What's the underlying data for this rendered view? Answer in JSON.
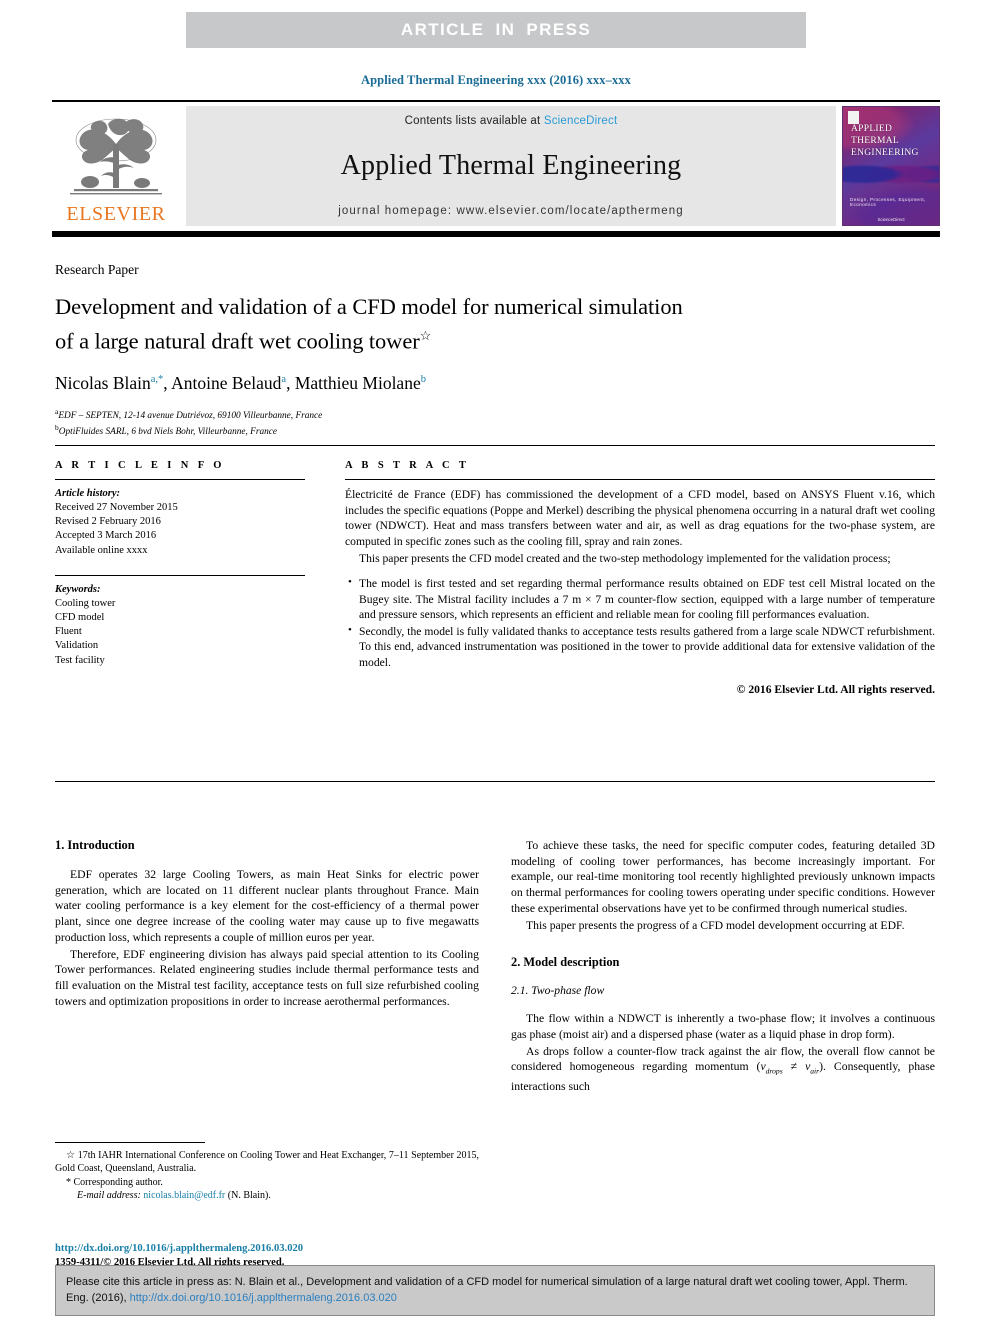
{
  "banner": {
    "text": "ARTICLE IN PRESS"
  },
  "running_head": "Applied Thermal Engineering xxx (2016) xxx–xxx",
  "masthead": {
    "contents_prefix": "Contents lists available at ",
    "sciencedirect": "ScienceDirect",
    "journal_title": "Applied Thermal Engineering",
    "homepage": "journal homepage: www.elsevier.com/locate/apthermeng",
    "publisher_wordmark": "ELSEVIER",
    "cover": {
      "line1": "APPLIED",
      "line2": "THERMAL",
      "line3": "ENGINEERING",
      "subtitle": "Design, Processes, Equipment, Economics",
      "footer": "ScienceDirect"
    }
  },
  "article": {
    "kind": "Research Paper",
    "title_line1": "Development and validation of a CFD model for numerical simulation",
    "title_line2": "of a large natural draft wet cooling tower",
    "title_star": "☆",
    "authors": [
      {
        "name": "Nicolas Blain",
        "marks": "a,*"
      },
      {
        "name": "Antoine Belaud",
        "marks": "a"
      },
      {
        "name": "Matthieu Miolane",
        "marks": "b"
      }
    ],
    "affiliations": [
      {
        "mark": "a",
        "text": "EDF – SEPTEN, 12-14 avenue Dutriévoz, 69100 Villeurbanne, France"
      },
      {
        "mark": "b",
        "text": "OptiFluides SARL, 6 bvd Niels Bohr, Villeurbanne, France"
      }
    ]
  },
  "article_info": {
    "heading": "A R T I C L E  I N F O",
    "history_label": "Article history:",
    "history": [
      "Received 27 November 2015",
      "Revised 2 February 2016",
      "Accepted 3 March 2016",
      "Available online xxxx"
    ],
    "keywords_label": "Keywords:",
    "keywords": [
      "Cooling tower",
      "CFD model",
      "Fluent",
      "Validation",
      "Test facility"
    ]
  },
  "abstract": {
    "heading": "A B S T R A C T",
    "paragraph1": "Électricité de France (EDF) has commissioned the development of a CFD model, based on ANSYS Fluent v.16, which includes the specific equations (Poppe and Merkel) describing the physical phenomena occurring in a natural draft wet cooling tower (NDWCT). Heat and mass transfers between water and air, as well as drag equations for the two-phase system, are computed in specific zones such as the cooling fill, spray and rain zones.",
    "paragraph2": "This paper presents the CFD model created and the two-step methodology implemented for the validation process;",
    "bullets": [
      "The model is first tested and set regarding thermal performance results obtained on EDF test cell Mistral located on the Bugey site. The Mistral facility includes a 7 m × 7 m counter-flow section, equipped with a large number of temperature and pressure sensors, which represents an efficient and reliable mean for cooling fill performances evaluation.",
      "Secondly, the model is fully validated thanks to acceptance tests results gathered from a large scale NDWCT refurbishment. To this end, advanced instrumentation was positioned in the tower to provide additional data for extensive validation of the model."
    ],
    "copyright": "© 2016 Elsevier Ltd. All rights reserved."
  },
  "body": {
    "left": {
      "section1_heading": "1. Introduction",
      "p1": "EDF operates 32 large Cooling Towers, as main Heat Sinks for electric power generation, which are located on 11 different nuclear plants throughout France. Main water cooling performance is a key element for the cost-efficiency of a thermal power plant, since one degree increase of the cooling water may cause up to five megawatts production loss, which represents a couple of million euros per year.",
      "p2": "Therefore, EDF engineering division has always paid special attention to its Cooling Tower performances. Related engineering studies include thermal performance tests and fill evaluation on the Mistral test facility, acceptance tests on full size refurbished cooling towers and optimization propositions in order to increase aerothermal performances."
    },
    "right": {
      "p1": "To achieve these tasks, the need for specific computer codes, featuring detailed 3D modeling of cooling tower performances, has become increasingly important. For example, our real-time monitoring tool recently highlighted previously unknown impacts on thermal performances for cooling towers operating under specific conditions. However these experimental observations have yet to be confirmed through numerical studies.",
      "p2": "This paper presents the progress of a CFD model development occurring at EDF.",
      "section2_heading": "2. Model description",
      "subsection21_heading": "2.1. Two-phase flow",
      "p3": "The flow within a NDWCT is inherently a two-phase flow; it involves a continuous gas phase (moist air) and a dispersed phase (water as a liquid phase in drop form).",
      "p4_part1": "As drops follow a counter-flow track against the air flow, the overall flow cannot be considered homogeneous regarding momentum (",
      "p4_vec1": "v",
      "p4_sub1": "drops",
      "p4_neq": " ≠ ",
      "p4_vec2": "v",
      "p4_sub2": "air",
      "p4_part2": "). Consequently, phase interactions such"
    }
  },
  "footnotes": {
    "fn_star_mark": "☆",
    "fn_star": "17th IAHR International Conference on Cooling Tower and Heat Exchanger, 7–11 September 2015, Gold Coast, Queensland, Australia.",
    "fn_corr_mark": "*",
    "fn_corr": "Corresponding author.",
    "email_label": "E-mail address:",
    "email": "nicolas.blain@edf.fr",
    "email_suffix": "(N. Blain).",
    "doi": "http://dx.doi.org/10.1016/j.applthermaleng.2016.03.020",
    "issn": "1359-4311/© 2016 Elsevier Ltd. All rights reserved."
  },
  "citation_footer": {
    "text_before": "Please cite this article in press as: N. Blain et al., Development and validation of a CFD model for numerical simulation of a large natural draft wet cooling tower, Appl. Therm. Eng. (2016), ",
    "link": "http://dx.doi.org/10.1016/j.applthermaleng.2016.03.020"
  },
  "colors": {
    "banner_bg": "#c7c8ca",
    "link_blue": "#1a7fa8",
    "sciencedirect_blue": "#2a9ad6",
    "elsevier_orange": "#e87722",
    "masthead_grey": "#e6e6e6",
    "footer_grey": "#c9c9c9"
  }
}
